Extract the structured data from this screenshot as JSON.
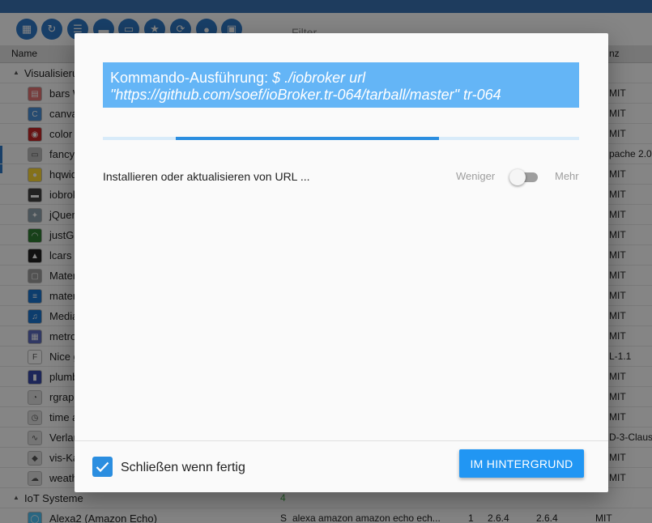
{
  "background": {
    "filter_label": "Filter",
    "columns": {
      "name": "Name",
      "license": "nz"
    },
    "groups": [
      {
        "label": "Visualisierung",
        "count": ""
      },
      {
        "label": "IoT Systeme",
        "count": "4"
      }
    ],
    "rows": [
      {
        "name": "bars W",
        "license": "MIT",
        "icon": "bars-icon",
        "color": "#e57373"
      },
      {
        "name": "canva",
        "license": "MIT",
        "icon": "canvas-icon",
        "color": "#4a90d9"
      },
      {
        "name": "color",
        "license": "MIT",
        "icon": "color-wheel-icon",
        "color": "#c62828"
      },
      {
        "name": "fancy",
        "license": "pache 2.0",
        "icon": "switch-icon",
        "color": "#bdbdbd"
      },
      {
        "name": "hqwid",
        "license": "MIT",
        "icon": "bulb-icon",
        "color": "#fdd835"
      },
      {
        "name": "iobrok",
        "license": "MIT",
        "icon": "panel-icon",
        "color": "#424242"
      },
      {
        "name": "jQuer",
        "license": "MIT",
        "icon": "jquery-icon",
        "color": "#90a4ae"
      },
      {
        "name": "justGa",
        "license": "MIT",
        "icon": "gauge-icon",
        "color": "#2e7d32"
      },
      {
        "name": "lcars",
        "license": "MIT",
        "icon": "lcars-icon",
        "color": "#212121"
      },
      {
        "name": "Mater",
        "license": "MIT",
        "icon": "material-icon",
        "color": "#9e9e9e"
      },
      {
        "name": "mater",
        "license": "MIT",
        "icon": "list-icon",
        "color": "#1976d2"
      },
      {
        "name": "Media",
        "license": "MIT",
        "icon": "music-icon",
        "color": "#1976d2"
      },
      {
        "name": "metro",
        "license": "MIT",
        "icon": "metro-icon",
        "color": "#5c6bc0"
      },
      {
        "name": "Nice g",
        "license": "L-1.1",
        "icon": "fonts-icon",
        "color": "#ffffff"
      },
      {
        "name": "plumb",
        "license": "MIT",
        "icon": "plumb-icon",
        "color": "#3949ab"
      },
      {
        "name": "rgrap",
        "license": "MIT",
        "icon": "gauge-dial-icon",
        "color": "#e0e0e0"
      },
      {
        "name": "time a",
        "license": "MIT",
        "icon": "clock-icon",
        "color": "#e0e0e0"
      },
      {
        "name": "Verlau",
        "license": "D-3-Claus",
        "icon": "chart-icon",
        "color": "#e0e0e0"
      },
      {
        "name": "vis-Ka",
        "license": "MIT",
        "icon": "vis-icon",
        "color": "#e0e0e0"
      },
      {
        "name": "weath",
        "license": "MIT",
        "icon": "weather-icon",
        "color": "#e0e0e0"
      }
    ],
    "alexa_row": {
      "name": "Alexa2 (Amazon Echo)",
      "type": "S",
      "keywords": "alexa amazon amazon echo ech...",
      "installs": "1",
      "available": "2.6.4",
      "installed": "2.6.4",
      "license": "MIT"
    }
  },
  "dialog": {
    "command_prefix": "Kommando-Ausführung: ",
    "command": "$ ./iobroker url \"https://github.com/soef/ioBroker.tr-064/tarball/master\" tr-064",
    "status_text": "Installieren oder aktualisieren von URL ...",
    "less_label": "Weniger",
    "more_label": "Mehr",
    "toggle_on": false,
    "close_when_done_label": "Schließen wenn fertig",
    "close_when_done_checked": true,
    "background_button_label": "IM HINTERGRUND",
    "accent_color": "#2196f3"
  }
}
